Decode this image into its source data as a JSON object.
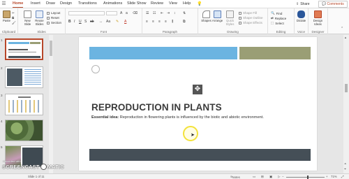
{
  "ribbon_tabs": [
    "Home",
    "Insert",
    "Draw",
    "Design",
    "Transitions",
    "Animations",
    "Slide Show",
    "Review",
    "View",
    "Help"
  ],
  "tell_me_placeholder": "",
  "share_label": "Share",
  "comments_label": "Comments",
  "groups": {
    "clipboard": {
      "label": "Clipboard",
      "paste": "Paste"
    },
    "slides": {
      "label": "Slides",
      "new_slide": "New Slide",
      "reuse_slides": "Reuse Slides",
      "layout": "Layout",
      "reset": "Reset",
      "section": "Section"
    },
    "font": {
      "label": "Font"
    },
    "paragraph": {
      "label": "Paragraph"
    },
    "drawing": {
      "label": "Drawing",
      "shapes": "Shapes",
      "arrange": "Arrange",
      "quick_styles": "Quick Styles",
      "shape_fill": "Shape Fill",
      "shape_outline": "Shape Outline",
      "shape_effects": "Shape Effects"
    },
    "editing": {
      "label": "Editing",
      "find": "Find",
      "replace": "Replace",
      "select": "Select"
    },
    "voice": {
      "label": "Voice",
      "dictate": "Dictate"
    },
    "designer": {
      "label": "Designer",
      "design_ideas": "Design Ideas"
    }
  },
  "thumbnail_numbers": [
    "1",
    "2",
    "3",
    "4",
    "5"
  ],
  "slide": {
    "title": "REPRODUCTION IN PLANTS",
    "essential_label": "Essential idea:",
    "essential_text": " Reproduction in flowering plants is influenced by the biotic and abiotic environment."
  },
  "status": {
    "slide_counter": "Slide 1 of 11",
    "notes": "Notes",
    "zoom": "71%"
  },
  "watermark": "SCREENCAST",
  "watermark_suffix": "MATIC",
  "watermark_small": "Recorded with",
  "colors": {
    "accent": "#b7472a",
    "bar_blue": "#6bb4e1",
    "bar_olive": "#9a9e75",
    "bar_dark": "#454f57",
    "cursor_highlight": "#f3e23a"
  }
}
